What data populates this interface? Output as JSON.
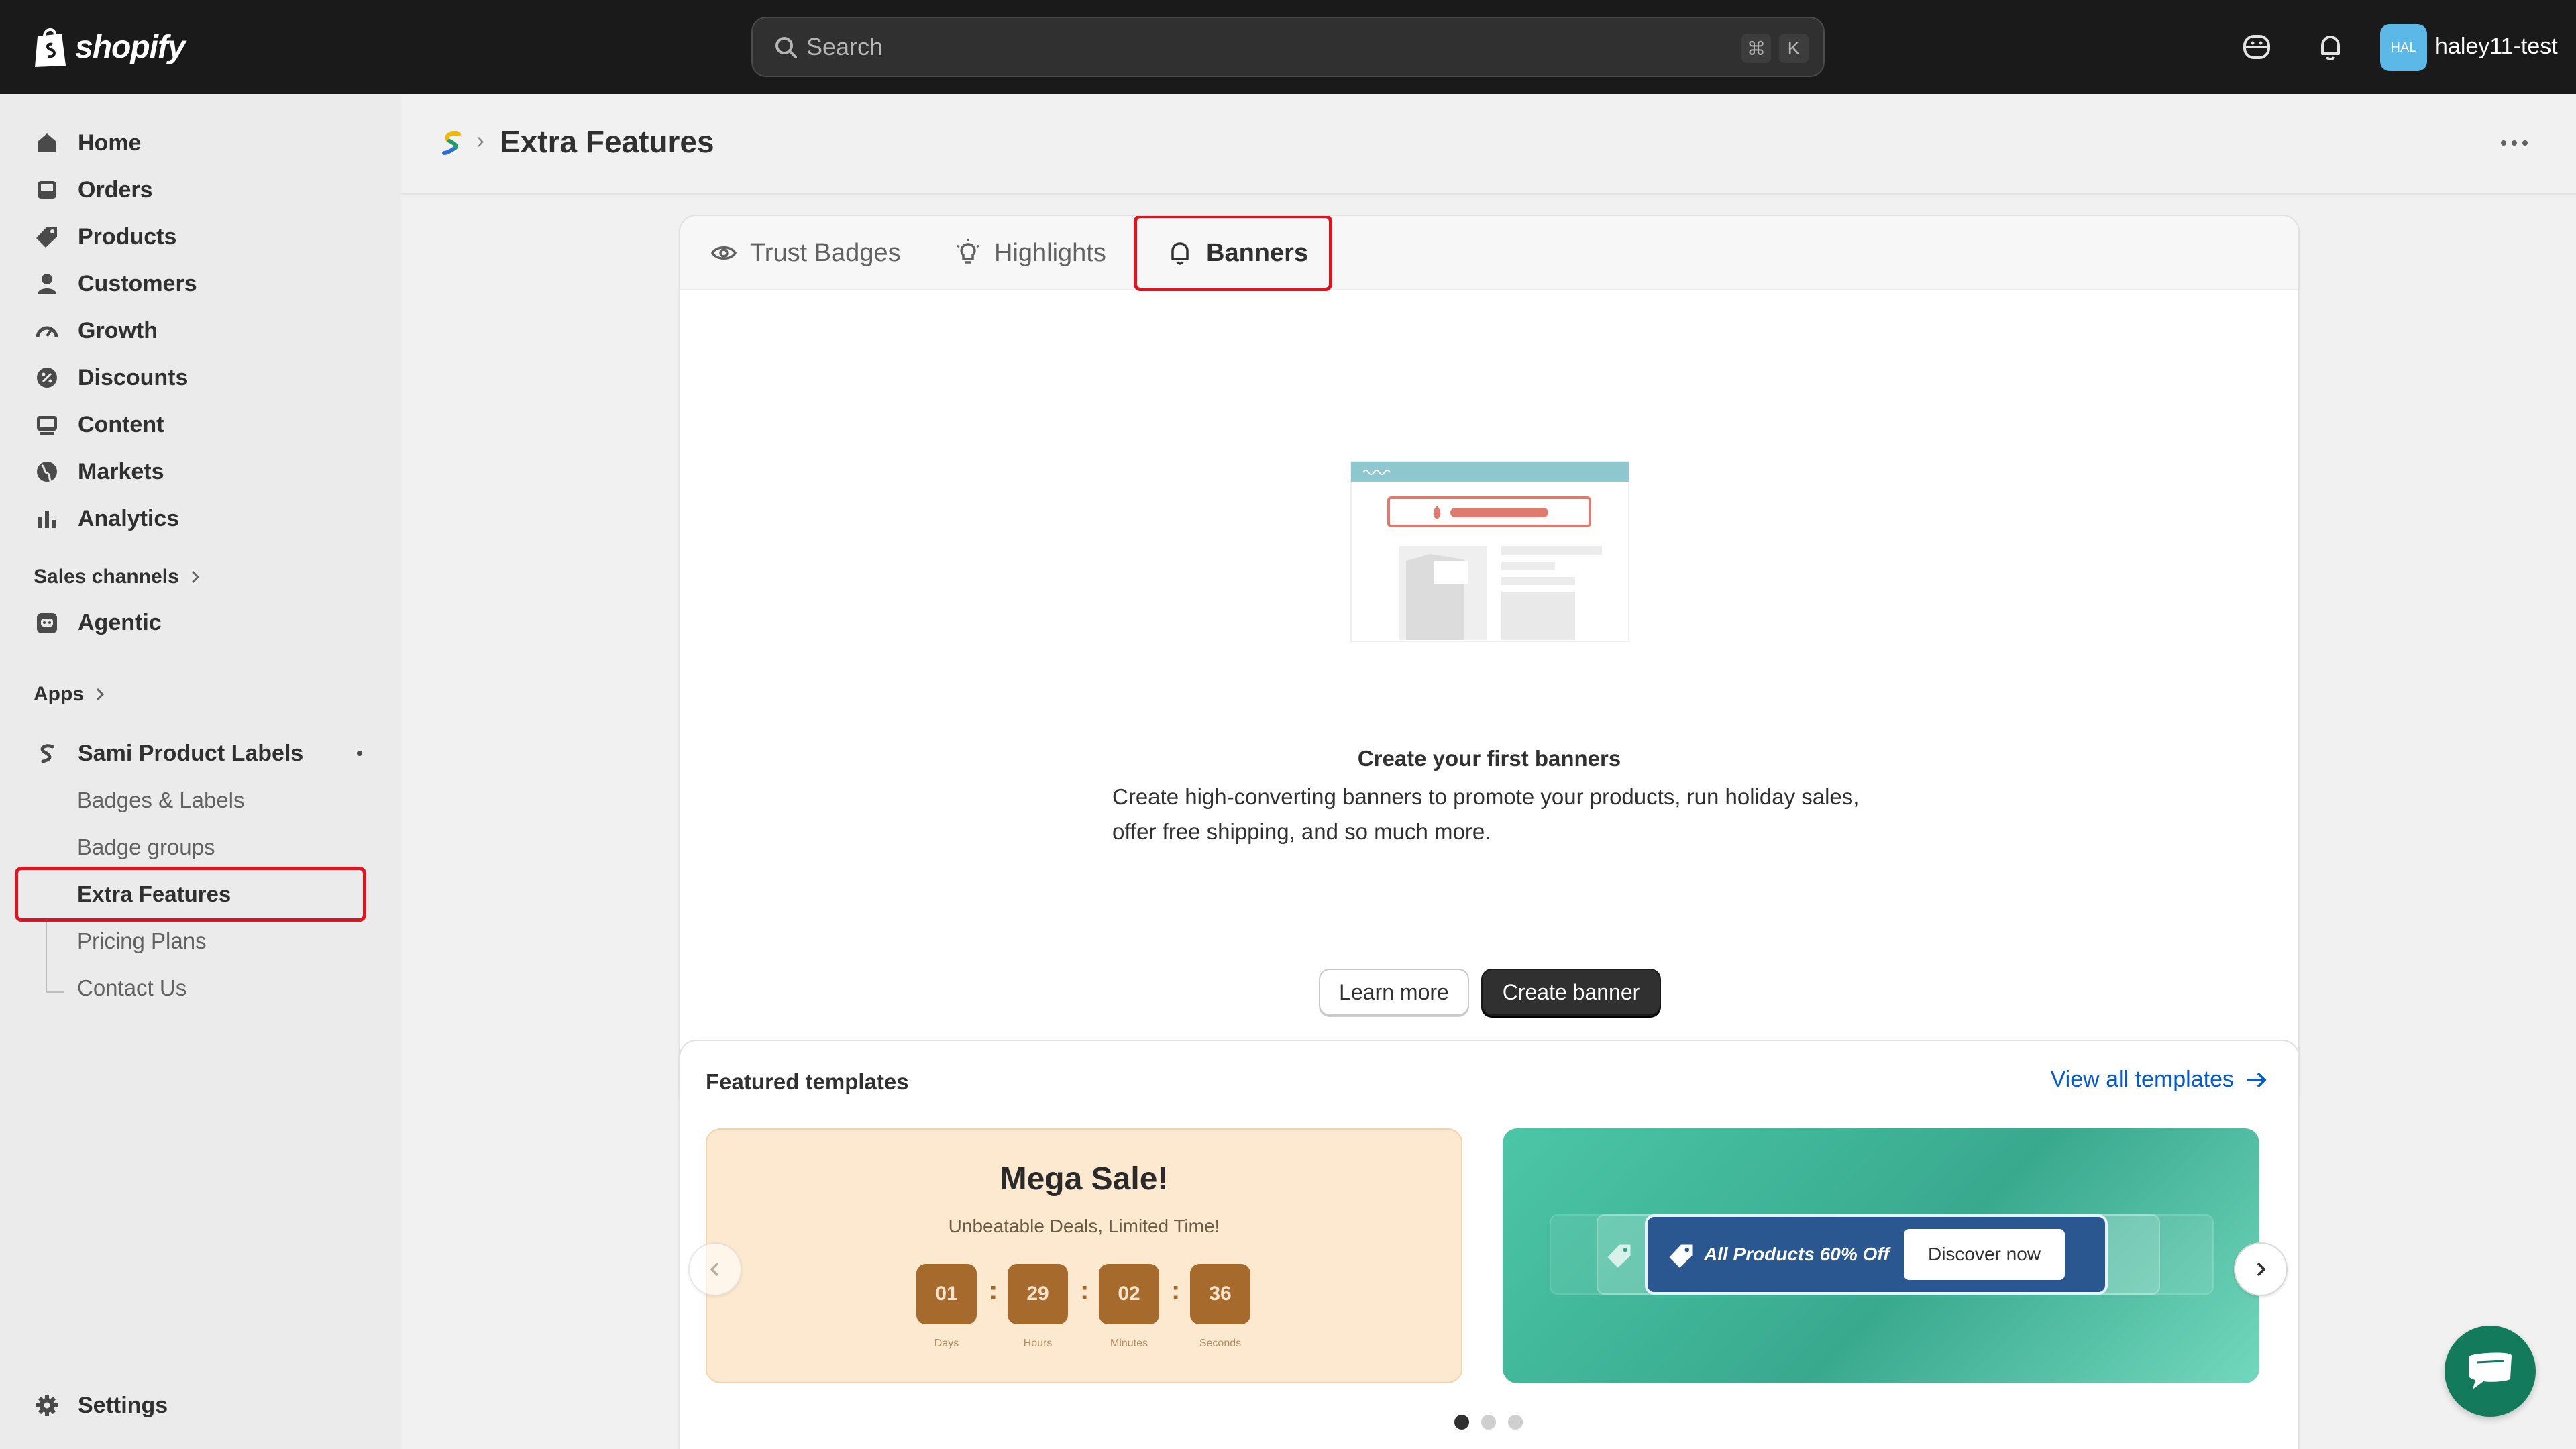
{
  "topbar": {
    "logo_text": "shopify",
    "search_placeholder": "Search",
    "shortcut_key1": "⌘",
    "shortcut_key2": "K",
    "avatar_initials": "HAL",
    "store_name": "haley11-test"
  },
  "sidebar": {
    "items": [
      {
        "label": "Home",
        "icon": "home-icon"
      },
      {
        "label": "Orders",
        "icon": "inbox-icon"
      },
      {
        "label": "Products",
        "icon": "tag-icon"
      },
      {
        "label": "Customers",
        "icon": "person-icon"
      },
      {
        "label": "Growth",
        "icon": "gauge-icon"
      },
      {
        "label": "Discounts",
        "icon": "discount-icon"
      },
      {
        "label": "Content",
        "icon": "content-icon"
      },
      {
        "label": "Markets",
        "icon": "globe-icon"
      },
      {
        "label": "Analytics",
        "icon": "chart-icon"
      }
    ],
    "sales_channels_label": "Sales channels",
    "agentic_label": "Agentic",
    "apps_label": "Apps",
    "app_name": "Sami Product Labels",
    "app_subitems": [
      "Badges & Labels",
      "Badge groups",
      "Extra Features",
      "Pricing Plans",
      "Contact Us"
    ],
    "active_subitem": "Extra Features",
    "settings_label": "Settings"
  },
  "page": {
    "title": "Extra Features"
  },
  "tabs": [
    {
      "label": "Trust Badges",
      "icon": "eye-icon"
    },
    {
      "label": "Highlights",
      "icon": "lightbulb-icon"
    },
    {
      "label": "Banners",
      "icon": "bell-icon",
      "active": true
    }
  ],
  "empty_state": {
    "title": "Create your first banners",
    "description": "Create high-converting banners to promote your products, run holiday sales, offer free shipping, and so much more.",
    "learn_more": "Learn more",
    "create": "Create banner"
  },
  "featured": {
    "title": "Featured templates",
    "view_all": "View all templates",
    "template1": {
      "headline": "Mega Sale!",
      "subline": "Unbeatable Deals, Limited Time!",
      "countdown": [
        {
          "value": "01",
          "unit": "Days"
        },
        {
          "value": "29",
          "unit": "Hours"
        },
        {
          "value": "02",
          "unit": "Minutes"
        },
        {
          "value": "36",
          "unit": "Seconds"
        }
      ]
    },
    "template2": {
      "text": "All Products 60% Off",
      "button": "Discover now"
    },
    "carousel_page": 1,
    "carousel_pages": 3
  },
  "colors": {
    "topbar": "#1a1a1a",
    "highlight": "#e0141e",
    "primary_button": "#303030",
    "link": "#005bd3",
    "chat": "#137a5c"
  }
}
